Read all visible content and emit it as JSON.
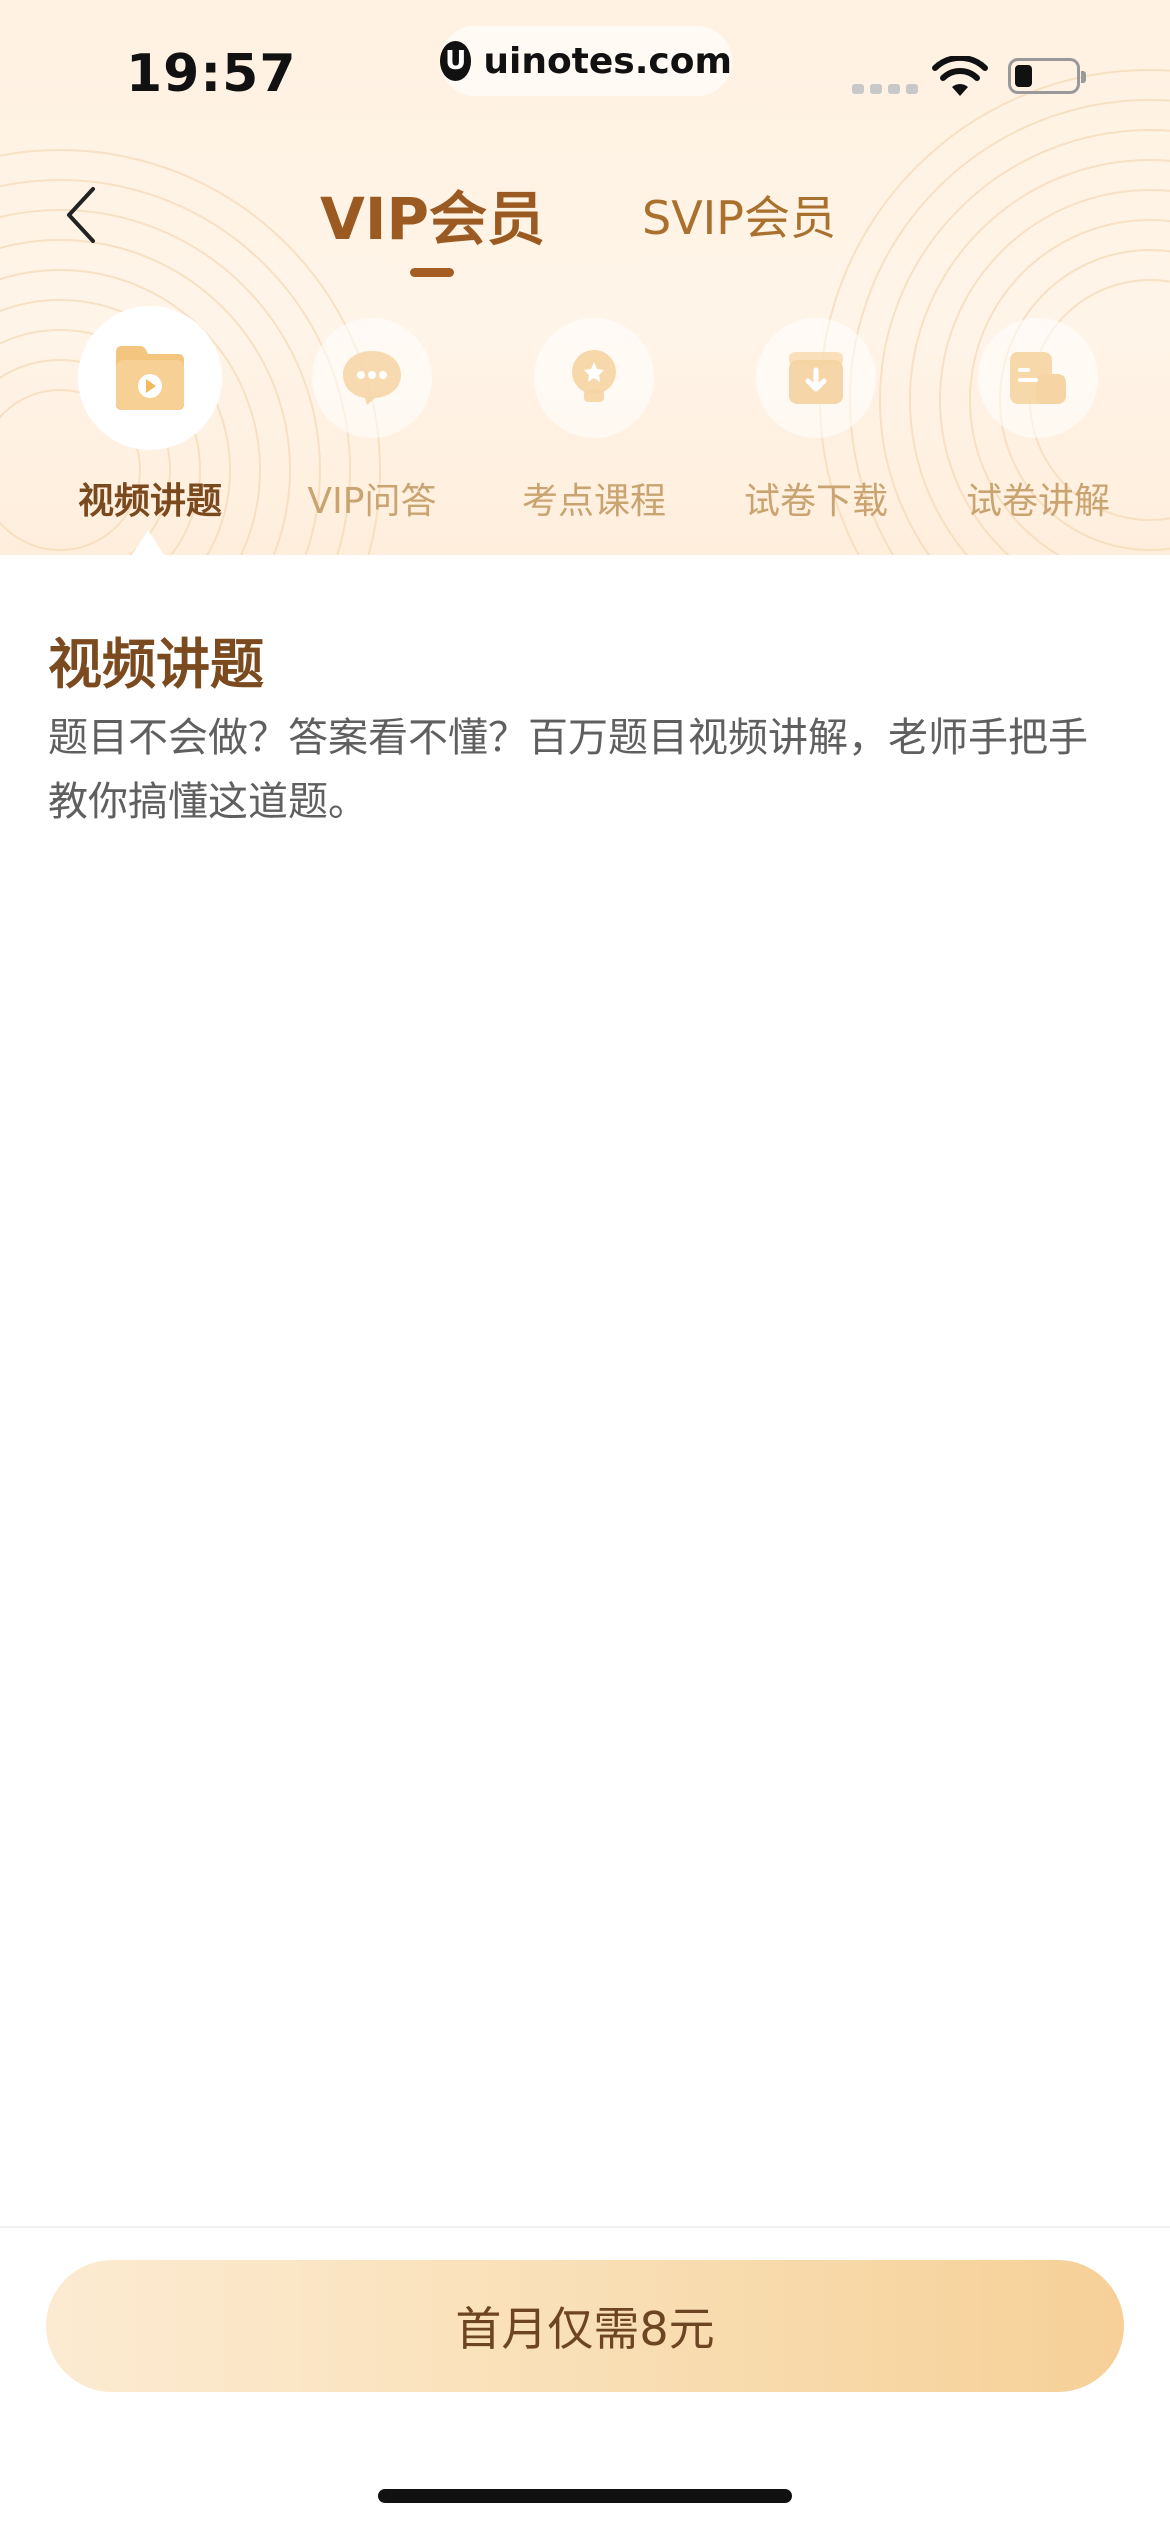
{
  "status_bar": {
    "time": "19:57",
    "url": "uinotes.com",
    "url_logo_letter": "U",
    "battery_level": 0.3
  },
  "nav": {
    "back_icon": "chevron-left-icon",
    "tabs": [
      {
        "label": "VIP会员",
        "active": true
      },
      {
        "label": "SVIP会员",
        "active": false
      }
    ]
  },
  "features": [
    {
      "label": "视频讲题",
      "icon": "video-folder-icon",
      "active": true
    },
    {
      "label": "VIP问答",
      "icon": "chat-bubble-icon",
      "active": false
    },
    {
      "label": "考点课程",
      "icon": "lightbulb-icon",
      "active": false
    },
    {
      "label": "试卷下载",
      "icon": "download-box-icon",
      "active": false
    },
    {
      "label": "试卷讲解",
      "icon": "document-icon",
      "active": false
    }
  ],
  "section": {
    "title": "视频讲题",
    "description": "题目不会做？答案看不懂？百万题目视频讲解，老师手把手教你搞懂这道题。"
  },
  "cta": {
    "label": "首月仅需8元"
  },
  "colors": {
    "accent": "#9A5A22",
    "header_bg": "#FFF2E2",
    "cta_start": "#FCEBD2",
    "cta_end": "#F6D097"
  }
}
